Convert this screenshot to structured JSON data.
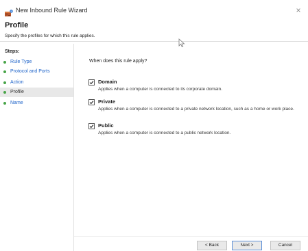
{
  "window": {
    "title": "New Inbound Rule Wizard",
    "close": "×"
  },
  "header": {
    "title": "Profile",
    "subtitle": "Specify the profiles for which this rule applies."
  },
  "steps": {
    "heading": "Steps:",
    "items": [
      {
        "label": "Rule Type",
        "current": false
      },
      {
        "label": "Protocol and Ports",
        "current": false
      },
      {
        "label": "Action",
        "current": false
      },
      {
        "label": "Profile",
        "current": true
      },
      {
        "label": "Name",
        "current": false
      }
    ]
  },
  "main": {
    "question": "When does this rule apply?",
    "options": [
      {
        "label": "Domain",
        "checked": true,
        "description": "Applies when a computer is connected to its corporate domain."
      },
      {
        "label": "Private",
        "checked": true,
        "description": "Applies when a computer is connected to a private network location, such as a home or work place."
      },
      {
        "label": "Public",
        "checked": true,
        "description": "Applies when a computer is connected to a public network location."
      }
    ]
  },
  "buttons": {
    "back": "< Back",
    "next": "Next >",
    "cancel": "Cancel"
  },
  "colors": {
    "link": "#1d63c9",
    "step_dot": "#47a447",
    "selected_bg": "#e8e8e8"
  }
}
